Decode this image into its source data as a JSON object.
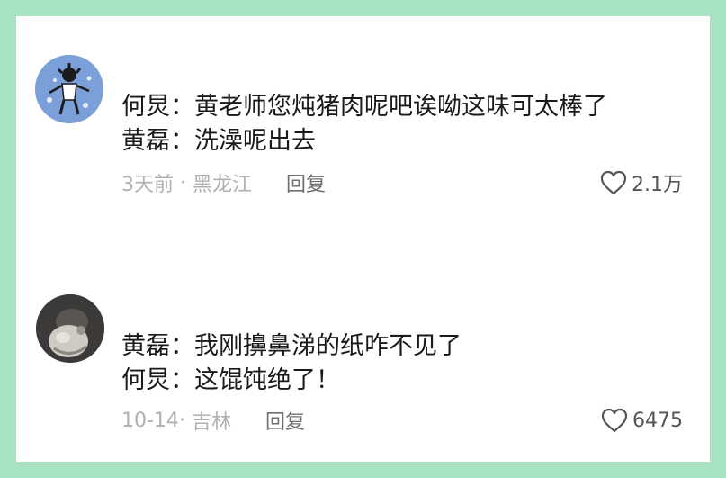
{
  "comments": [
    {
      "lines": [
        "何炅：黄老师您炖猪肉呢吧诶呦这味可太棒了",
        "黄磊：洗澡呢出去"
      ],
      "time": "3天前",
      "separator": " · ",
      "location": "黑龙江",
      "reply_label": "回复",
      "likes": "2.1万",
      "like_icon": "heart-outline-icon"
    },
    {
      "lines": [
        "黄磊：我刚擤鼻涕的纸咋不见了",
        "何炅：这馄饨绝了！"
      ],
      "time": "10-14",
      "separator": "· ",
      "location": "吉林",
      "reply_label": "回复",
      "likes": "6475",
      "like_icon": "heart-outline-icon"
    }
  ],
  "colors": {
    "frame": "#a8e3c2",
    "card": "#ffffff",
    "text": "#1a1a1a",
    "meta": "#b0b0b0",
    "reply": "#6f6f6f"
  }
}
